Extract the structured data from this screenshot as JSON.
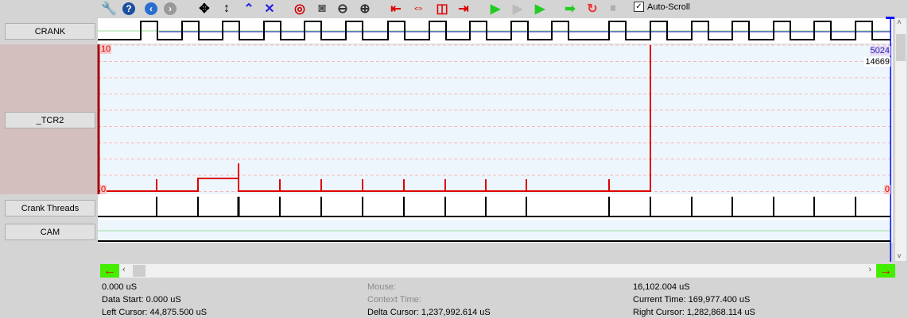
{
  "toolbar": {
    "icons": [
      "settings-icon",
      "help-icon",
      "back-icon",
      "forward-icon",
      "pan-icon",
      "fit-vertical-icon",
      "expand-icon",
      "collapse-icon",
      "zoom-reset-icon",
      "zoom-fit-icon",
      "zoom-out-icon",
      "zoom-in-icon",
      "cursor-left-icon",
      "cursor-both-icon",
      "cursor-center-icon",
      "cursor-right-icon",
      "go-start-icon",
      "step-icon",
      "go-end-icon",
      "play-icon",
      "reload-icon",
      "pause-icon"
    ],
    "auto_scroll_label": "Auto-Scroll",
    "auto_scroll_checked": true
  },
  "channels": [
    {
      "label": "CRANK"
    },
    {
      "label": "_TCR2"
    },
    {
      "label": "Crank Threads"
    },
    {
      "label": "CAM"
    }
  ],
  "tcr2": {
    "min_label": "0",
    "max_label": "10",
    "right_max": "5024",
    "right_value": "14669",
    "right_min": "0"
  },
  "colors": {
    "signal": "#e00000",
    "plot_bg": "#eef6fd",
    "cursor": "#0000ff"
  },
  "status": {
    "start_time": "0.000 uS",
    "data_start": "Data Start:  0.000 uS",
    "left_cursor": "Left Cursor:  44,875.500 uS",
    "mouse": "Mouse:",
    "context_time": "Context Time:",
    "delta_cursor": "Delta Cursor:  1,237,992.614 uS",
    "end_time": "16,102.004 uS",
    "current_time": "Current Time:  169,977.400 uS",
    "right_cursor": "Right Cursor:  1,282,868.114 uS"
  }
}
